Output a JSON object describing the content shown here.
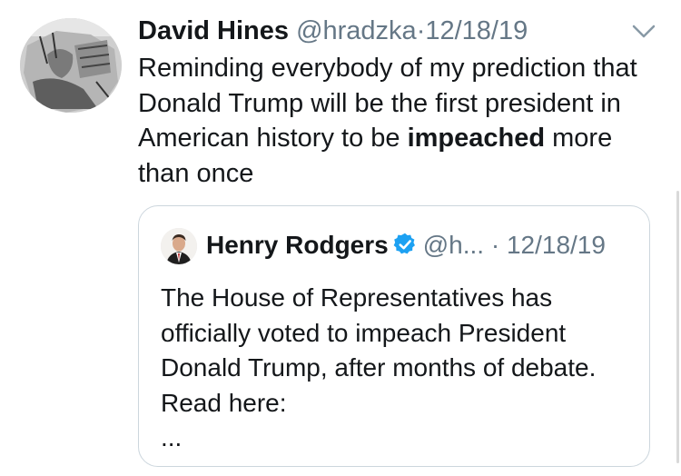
{
  "tweet": {
    "author_name": "David Hines",
    "author_handle": "@hradzka",
    "separator": "·",
    "date": "12/18/19",
    "text_before": "Reminding everybody of my prediction that Donald Trump will be the first president in American history to be ",
    "text_bold": "impeached",
    "text_after": " more than once",
    "menu_icon": "chevron-down-icon",
    "avatar_icon": "profile-avatar"
  },
  "quoted_tweet": {
    "author_name": "Henry Rodgers",
    "verified_icon": "verified-badge-icon",
    "author_handle": "@h...",
    "separator": "·",
    "date": "12/18/19",
    "text": "The House of Representatives has officially voted to impeach President Donald Trump, after months of debate. Read here:",
    "truncation": "...",
    "avatar_icon": "profile-avatar"
  },
  "colors": {
    "text": "#14171a",
    "muted": "#657786",
    "border": "#ccd6dd",
    "verified": "#1da1f2"
  }
}
